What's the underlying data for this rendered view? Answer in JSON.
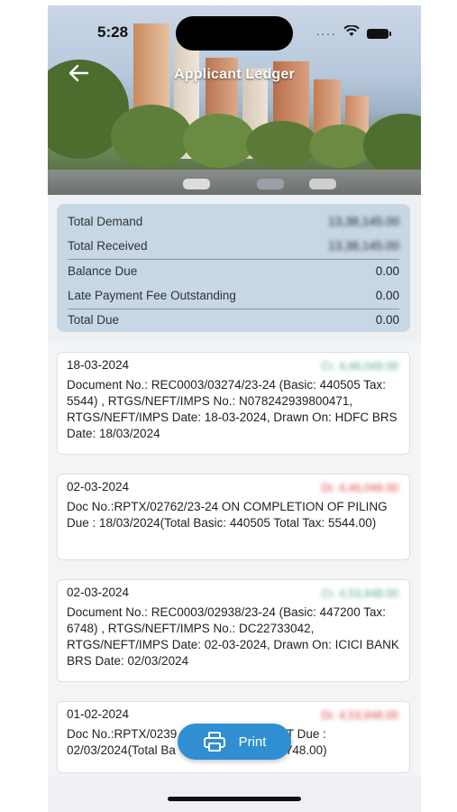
{
  "status_bar": {
    "time": "5:28",
    "signal": "····"
  },
  "header": {
    "title": "Applicant Ledger"
  },
  "summary": [
    {
      "label": "Total Demand",
      "value": "13,38,145.00",
      "blurred": true
    },
    {
      "label": "Total Received",
      "value": "13,38,145.00",
      "blurred": true
    },
    {
      "label": "Balance Due",
      "value": "0.00",
      "blurred": false
    },
    {
      "label": "Late Payment Fee Outstanding",
      "value": "0.00",
      "blurred": false
    },
    {
      "label": "Total Due",
      "value": "0.00",
      "blurred": false
    }
  ],
  "entries": [
    {
      "date": "18-03-2024",
      "amount": "Cr. 4,46,049.00",
      "type": "cr",
      "description": "Document No.: REC0003/03274/23-24 (Basic: 440505 Tax: 5544) , RTGS/NEFT/IMPS No.: N078242939800471, RTGS/NEFT/IMPS Date: 18-03-2024, Drawn On: HDFC BRS Date: 18/03/2024"
    },
    {
      "date": "02-03-2024",
      "amount": "Dr. 4,46,049.00",
      "type": "dr",
      "description": "Doc No.:RPTX/02762/23-24 ON COMPLETION OF PILING Due : 18/03/2024(Total Basic: 440505 Total Tax: 5544.00)"
    },
    {
      "date": "02-03-2024",
      "amount": "Cr. 4,53,948.00",
      "type": "cr",
      "description": "Document No.: REC0003/02938/23-24 (Basic: 447200 Tax: 6748) , RTGS/NEFT/IMPS No.: DC22733042, RTGS/NEFT/IMPS Date: 02-03-2024, Drawn On: ICICI BANK  BRS Date: 02/03/2024"
    },
    {
      "date": "01-02-2024",
      "amount": "Dr. 4,53,948.00",
      "type": "dr",
      "description": "Doc No.:RPTX/0239                      EMENT Due : 02/03/2024(Total Ba                    n Tax: 6748.00)"
    }
  ],
  "print_button": {
    "label": "Print"
  },
  "icons": {
    "back": "arrow-left-icon",
    "print": "printer-icon",
    "wifi": "wifi-icon",
    "battery": "battery-icon"
  }
}
